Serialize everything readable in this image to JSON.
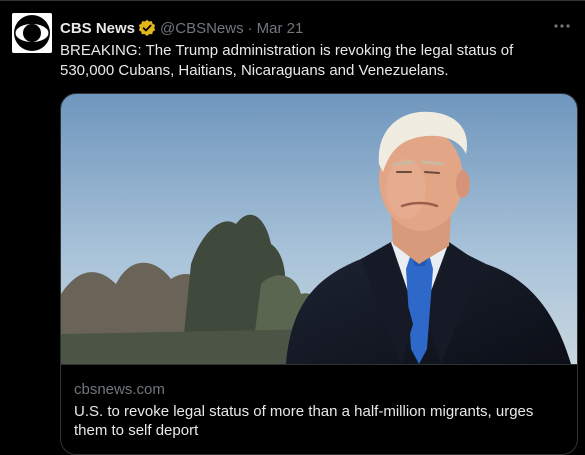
{
  "tweet": {
    "author_name": "CBS News",
    "author_handle": "@CBSNews",
    "separator": "·",
    "date": "Mar 21",
    "text": "BREAKING: The Trump administration is revoking the legal status of 530,000 Cubans, Haitians, Nicaraguans and Venezuelans.",
    "verified_icon": "gold-verified-badge-icon",
    "more_icon": "more-options-icon"
  },
  "card": {
    "domain": "cbsnews.com",
    "title": "U.S. to revoke legal status of more than a half-million migrants, urges them to self deport"
  },
  "colors": {
    "background": "#000000",
    "text": "#e7e9ea",
    "muted": "#71767b",
    "border": "#2f3336",
    "verified_gold": "#e2b719"
  }
}
